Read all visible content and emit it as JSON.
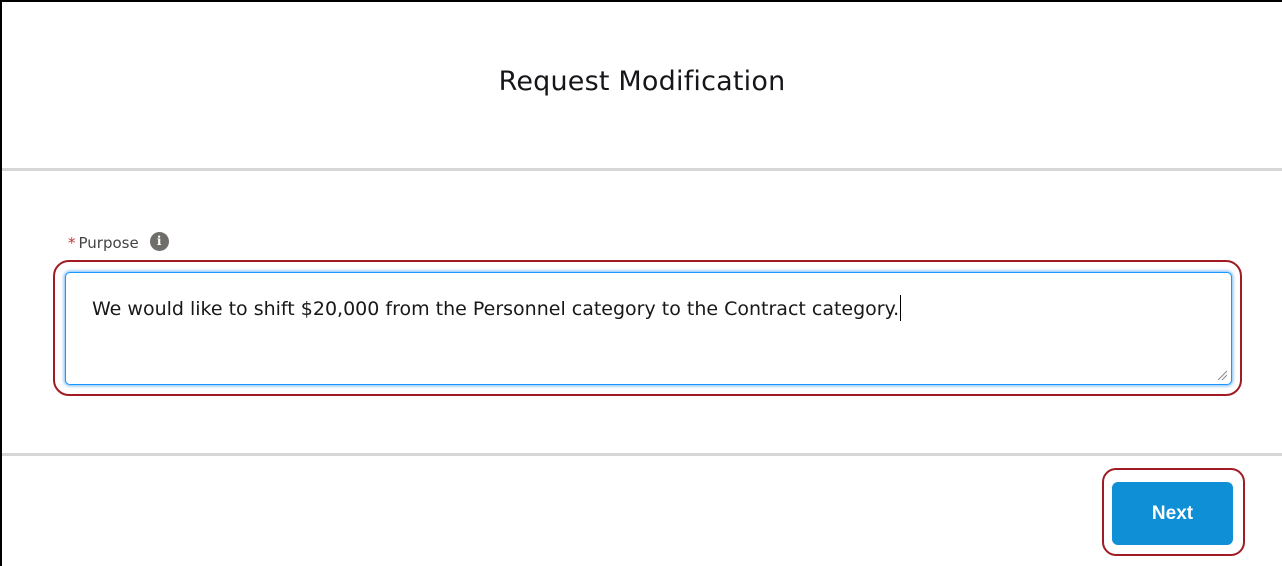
{
  "modal": {
    "title": "Request Modification"
  },
  "form": {
    "purpose": {
      "required_marker": "*",
      "label": "Purpose",
      "info_icon": "info-icon",
      "value": "We would like to shift $20,000 from the Personnel category to the Contract category."
    }
  },
  "footer": {
    "next_label": "Next"
  },
  "colors": {
    "accent": "#0e8fd6",
    "focus_border": "#1b96ff",
    "annotation": "#a01c24",
    "required": "#c23934"
  }
}
